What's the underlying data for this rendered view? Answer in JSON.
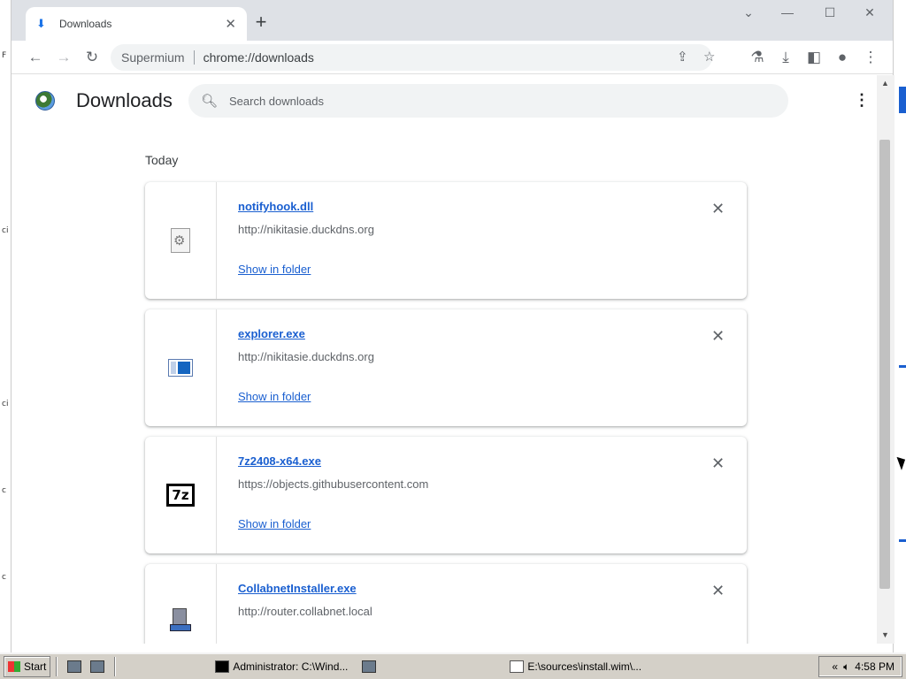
{
  "window": {
    "tab_title": "Downloads",
    "tab_close": "✕",
    "new_tab": "+",
    "minimize": "—",
    "maximize": "☐",
    "close": "✕",
    "collapse": "⌄"
  },
  "toolbar": {
    "site_label": "Supermium",
    "url": "chrome://downloads",
    "icons": [
      "back-icon",
      "forward-icon",
      "reload-icon",
      "share-icon",
      "star-icon",
      "extension-icon",
      "download-icon",
      "side-panel-icon",
      "profile-icon",
      "menu-icon"
    ]
  },
  "page": {
    "title": "Downloads",
    "search_placeholder": "Search downloads",
    "section_today": "Today"
  },
  "downloads": [
    {
      "name": "notifyhook.dll",
      "source": "http://nikitasie.duckdns.org",
      "action": "Show in folder",
      "icon": "dll-file-icon"
    },
    {
      "name": "explorer.exe",
      "source": "http://nikitasie.duckdns.org",
      "action": "Show in folder",
      "icon": "exe-window-icon"
    },
    {
      "name": "7z2408-x64.exe",
      "source": "https://objects.githubusercontent.com",
      "action": "Show in folder",
      "icon": "7zip-icon"
    },
    {
      "name": "CollabnetInstaller.exe",
      "source": "http://router.collabnet.local",
      "action": "",
      "icon": "installer-network-icon"
    }
  ],
  "taskbar": {
    "start": "Start",
    "task1": "Administrator: C:\\Wind...",
    "task2": "E:\\sources\\install.wim\\...",
    "clock": "4:58 PM"
  }
}
